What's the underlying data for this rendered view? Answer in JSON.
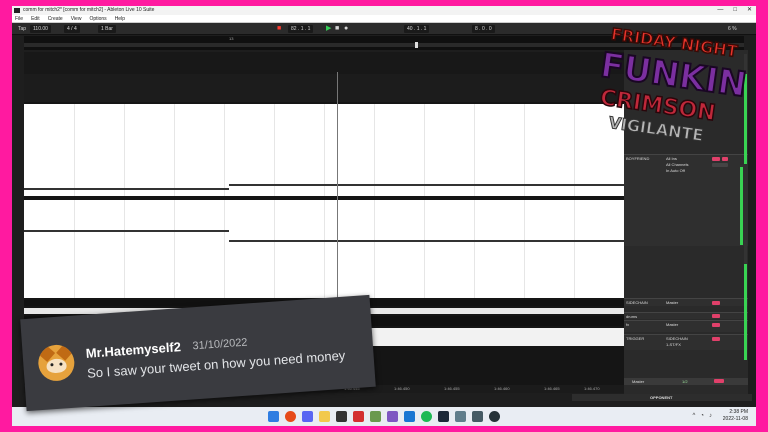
{
  "window": {
    "title": "comm for mitch2* [comm for mitch2] - Ableton Live 10 Suite",
    "buttons": [
      "—",
      "□",
      "✕"
    ]
  },
  "menu": [
    "File",
    "Edit",
    "Create",
    "View",
    "Options",
    "Help"
  ],
  "transport": {
    "tap": "Tap",
    "tempo": "110.00",
    "signature": "4 / 4",
    "bar": "1 Bar",
    "position": "82 .  1 .  1",
    "loop_start": "40 .  1 .  1",
    "loop_length": "8 .  0 .  0",
    "cpu": "6 %"
  },
  "overview": {
    "bar_label": "13"
  },
  "tracks": [
    {
      "name": "BOYFRIEND",
      "input": "All Ins",
      "channel": "All Channels",
      "monitor": "In Auto Off"
    },
    {
      "name": "SIDECHAIN",
      "input": "Master"
    },
    {
      "name": "drums",
      "input": ""
    },
    {
      "name": "fx",
      "input": "Master"
    },
    {
      "name": "TRIGGER",
      "input": "SIDECHAIN",
      "sub": "1-ST/FX"
    }
  ],
  "master": {
    "name": "Master",
    "value": "1/2"
  },
  "timeline": [
    "1:46.400",
    "1:46.426",
    "1:46.440",
    "1:46.445",
    "1:46.450",
    "1:46.455",
    "1:46.460",
    "1:46.465",
    "1:46.470"
  ],
  "opponent_label": "OPPONENT",
  "tweet": {
    "username": "Mr.Hatemyself2",
    "date": "31/10/2022",
    "message": "So I saw your tweet on how you need money"
  },
  "logo": {
    "line1": "FRIDAY NIGHT",
    "line2": "FUNKIN",
    "line3": "CRIMSON",
    "line4": "VIGILANTE"
  },
  "clock": {
    "time": "2:38 PM",
    "date": "2022-11-08"
  },
  "colors": {
    "frame": "#ff1aa0",
    "accent_meter": "#39d353",
    "rec": "#ff3b30"
  }
}
